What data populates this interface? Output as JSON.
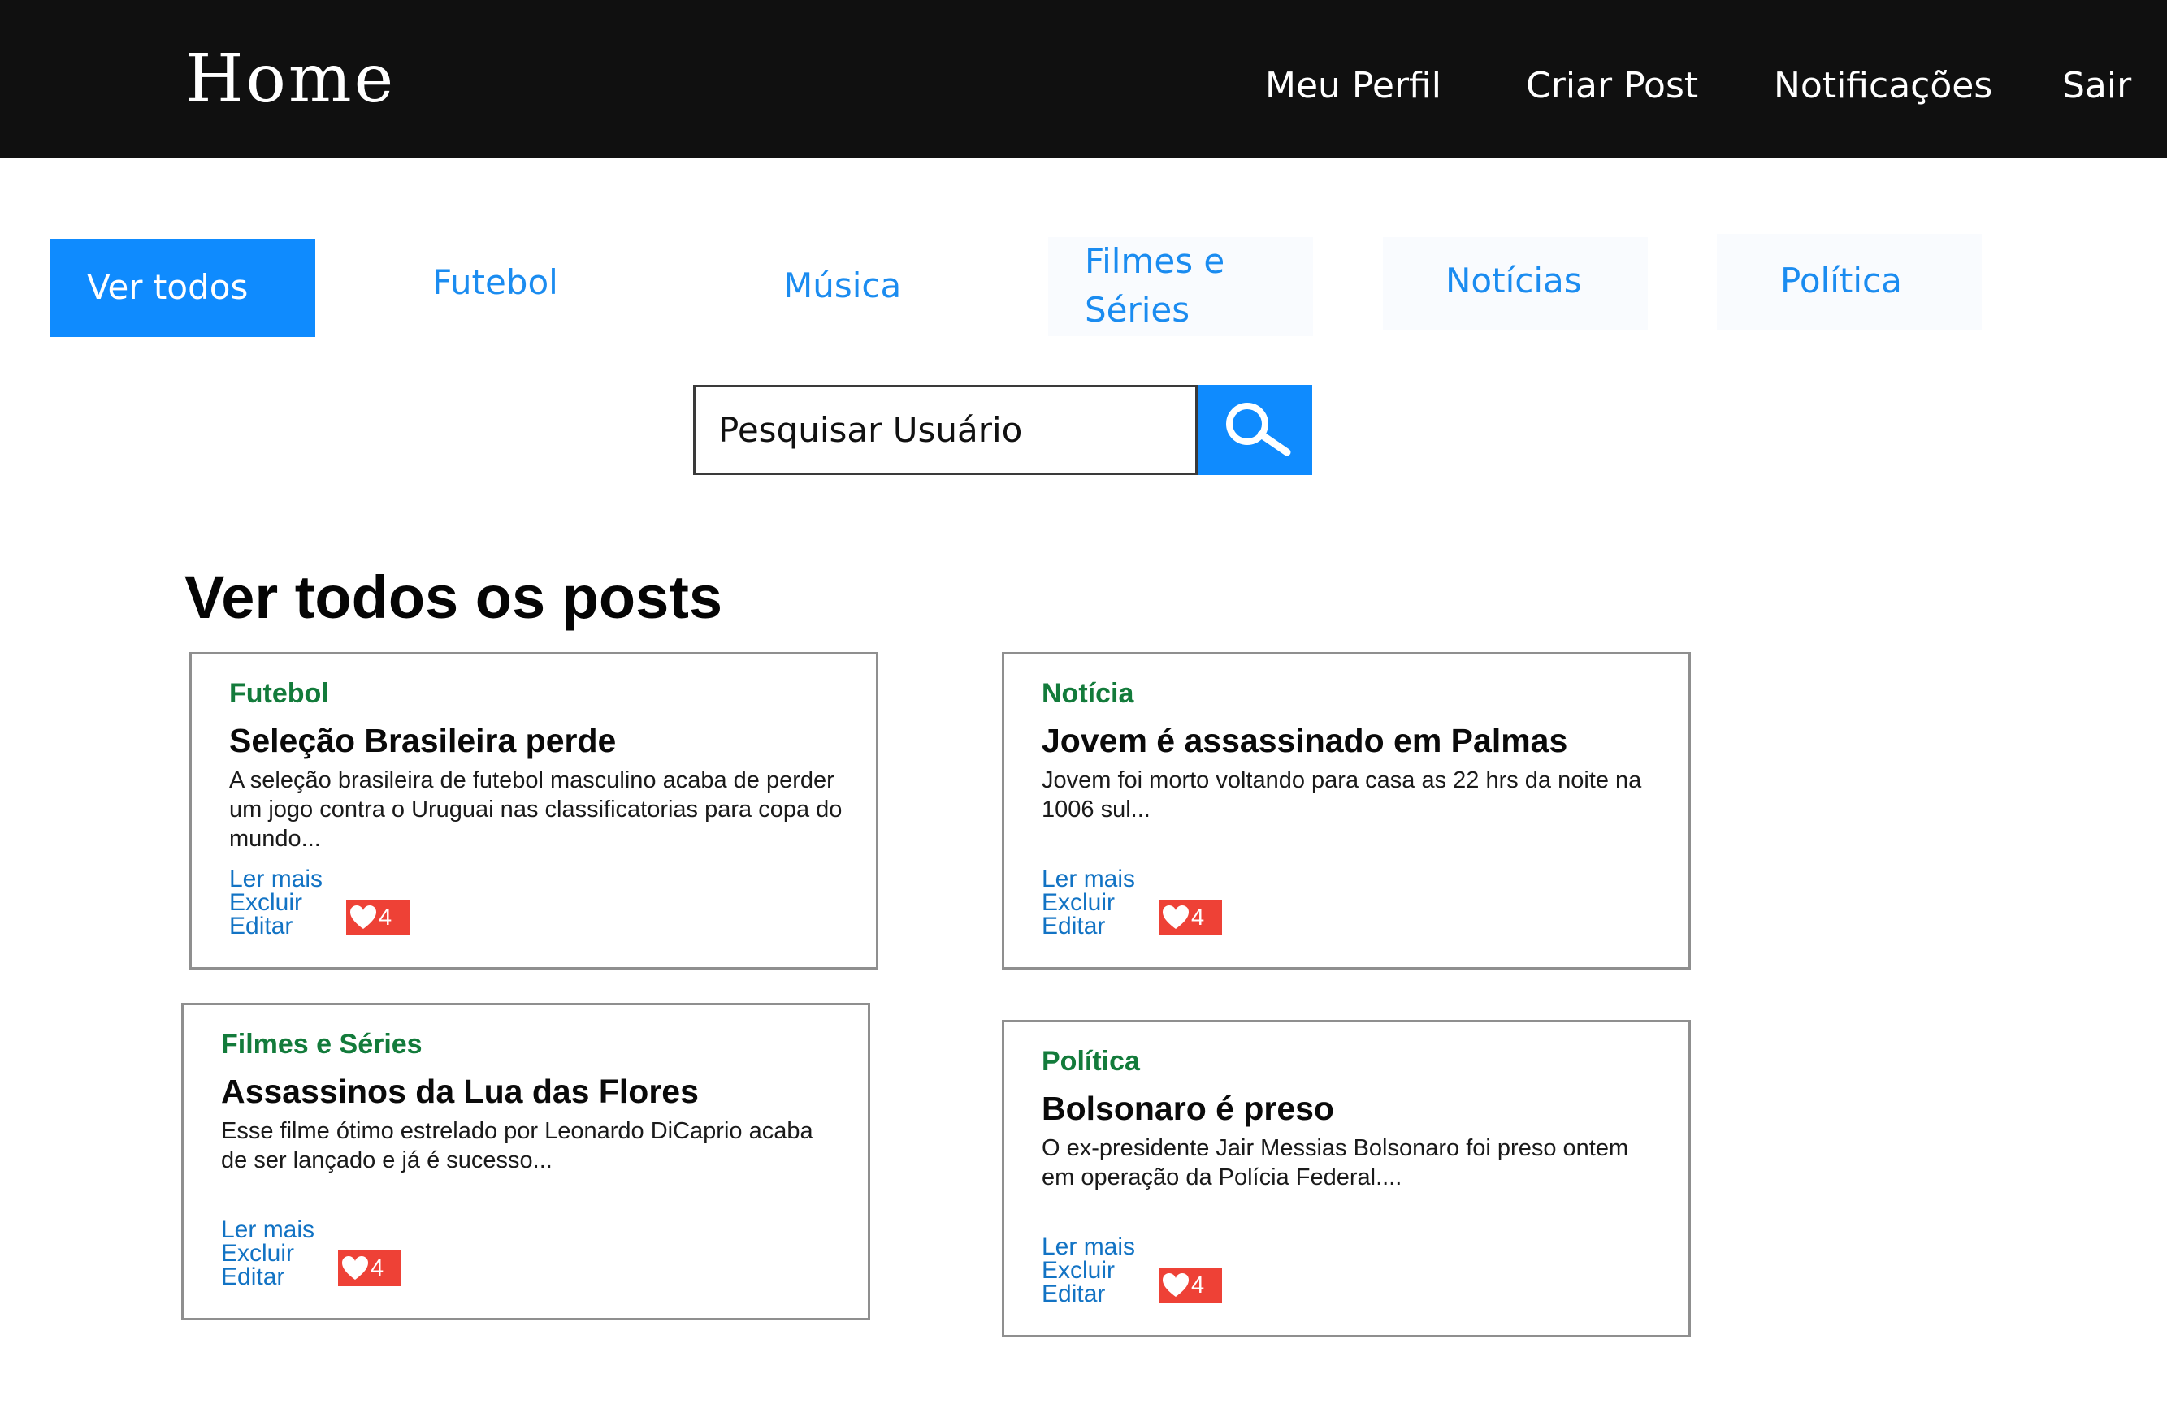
{
  "header": {
    "brand": "Home",
    "nav": [
      "Meu Perfil",
      "Criar Post",
      "Notificações",
      "Sair"
    ]
  },
  "categories": [
    {
      "label": "Ver todos",
      "active": true
    },
    {
      "label": "Futebol"
    },
    {
      "label": "Música"
    },
    {
      "label": "Filmes e Séries"
    },
    {
      "label": "Notícias"
    },
    {
      "label": "Política"
    }
  ],
  "search": {
    "placeholder": "Pesquisar Usuário",
    "button_icon": "search-icon"
  },
  "section_title": "Ver todos os posts",
  "posts": [
    {
      "category": "Futebol",
      "title": "Seleção Brasileira perde",
      "excerpt": "A seleção brasileira de futebol masculino acaba de perder um jogo contra o Uruguai nas classificatorias para copa do mundo...",
      "actions": [
        "Ler mais",
        "Excluir",
        "Editar"
      ],
      "likes": "4"
    },
    {
      "category": "Notícia",
      "title": "Jovem é assassinado em Palmas",
      "excerpt": "Jovem foi morto voltando para casa as 22 hrs da noite na 1006 sul...",
      "actions": [
        "Ler mais",
        "Excluir",
        "Editar"
      ],
      "likes": "4"
    },
    {
      "category": "Filmes e Séries",
      "title": "Assassinos da Lua das Flores",
      "excerpt": "Esse filme ótimo estrelado por Leonardo DiCaprio acaba de ser lançado e já é sucesso...",
      "actions": [
        "Ler mais",
        "Excluir",
        "Editar"
      ],
      "likes": "4"
    },
    {
      "category": "Política",
      "title": "Bolsonaro é preso",
      "excerpt": "O ex-presidente Jair Messias Bolsonaro foi preso ontem em operação da Polícia Federal....",
      "actions": [
        "Ler mais",
        "Excluir",
        "Editar"
      ],
      "likes": "4"
    }
  ],
  "colors": {
    "header_bg": "#101010",
    "accent": "#0f8bfe",
    "tab_text": "#1b8cf0",
    "category_green": "#137b3b",
    "link_blue": "#1273c4",
    "like_red": "#ee4136"
  }
}
